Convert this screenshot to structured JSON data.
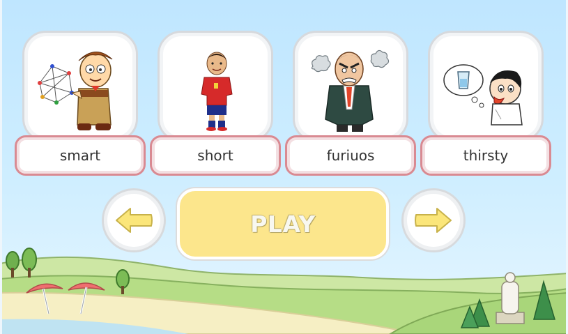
{
  "cards": [
    {
      "label": "smart",
      "icon": "smart-boy-icon"
    },
    {
      "label": "short",
      "icon": "footballer-icon"
    },
    {
      "label": "furiuos",
      "icon": "furious-man-icon"
    },
    {
      "label": "thirsty",
      "icon": "thirsty-boy-icon"
    }
  ],
  "controls": {
    "play_label": "PLAY",
    "prev_icon": "arrow-left-icon",
    "next_icon": "arrow-right-icon"
  },
  "colors": {
    "sky": "#bfe6ff",
    "card_border": "#d6d9dd",
    "word_border": "#d98a92",
    "play_bg": "#fce68c",
    "arrow": "#fbe67a"
  }
}
